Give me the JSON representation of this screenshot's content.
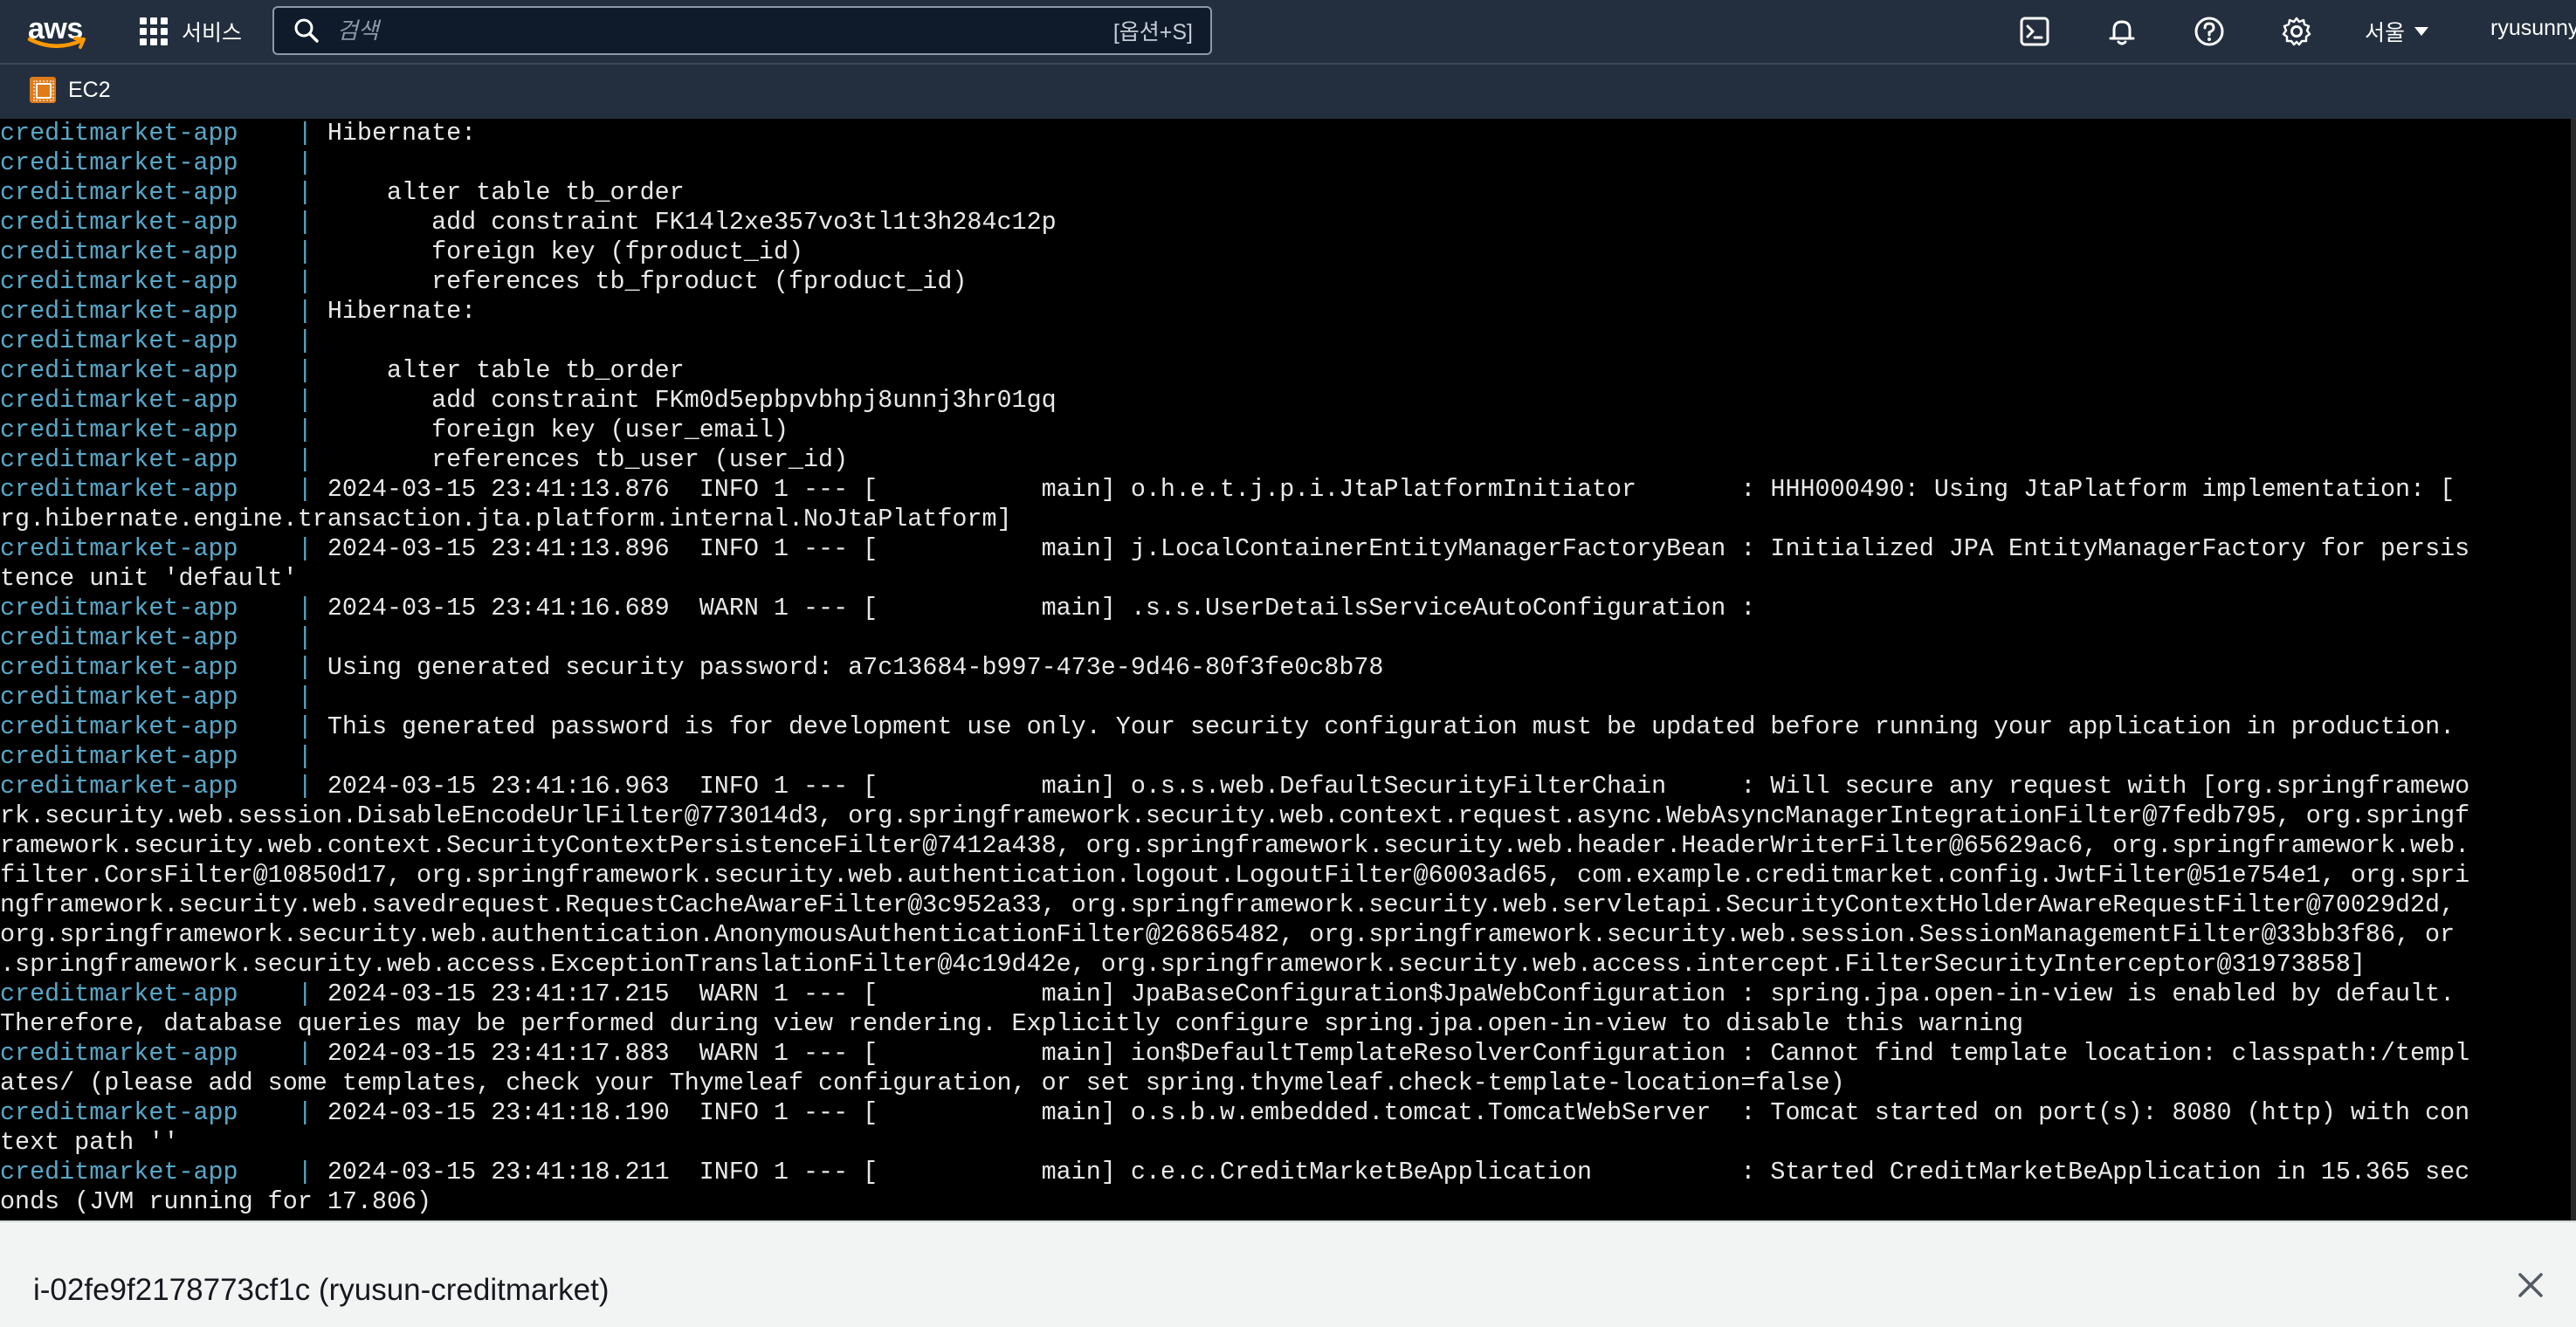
{
  "topnav": {
    "logo_text": "aws",
    "services_label": "서비스",
    "search_placeholder": "검색",
    "search_shortcut": "[옵션+S]",
    "region_label": "서울",
    "user_label": "ryusunny"
  },
  "service_bar": {
    "ec2_label": "EC2"
  },
  "terminal": {
    "prefix": "creditmarket-app    | ",
    "lines": [
      {
        "p": true,
        "t": "Hibernate:"
      },
      {
        "p": true,
        "t": ""
      },
      {
        "p": true,
        "t": "    alter table tb_order"
      },
      {
        "p": true,
        "t": "       add constraint FK14l2xe357vo3tl1t3h284c12p"
      },
      {
        "p": true,
        "t": "       foreign key (fproduct_id)"
      },
      {
        "p": true,
        "t": "       references tb_fproduct (fproduct_id)"
      },
      {
        "p": true,
        "t": "Hibernate:"
      },
      {
        "p": true,
        "t": ""
      },
      {
        "p": true,
        "t": "    alter table tb_order"
      },
      {
        "p": true,
        "t": "       add constraint FKm0d5epbpvbhpj8unnj3hr01gq"
      },
      {
        "p": true,
        "t": "       foreign key (user_email)"
      },
      {
        "p": true,
        "t": "       references tb_user (user_id)"
      },
      {
        "p": true,
        "t": "2024-03-15 23:41:13.876  INFO 1 --- [           main] o.h.e.t.j.p.i.JtaPlatformInitiator       : HHH000490: Using JtaPlatform implementation: ["
      },
      {
        "p": false,
        "t": "rg.hibernate.engine.transaction.jta.platform.internal.NoJtaPlatform]"
      },
      {
        "p": true,
        "t": "2024-03-15 23:41:13.896  INFO 1 --- [           main] j.LocalContainerEntityManagerFactoryBean : Initialized JPA EntityManagerFactory for persis"
      },
      {
        "p": false,
        "t": "tence unit 'default'"
      },
      {
        "p": true,
        "t": "2024-03-15 23:41:16.689  WARN 1 --- [           main] .s.s.UserDetailsServiceAutoConfiguration :"
      },
      {
        "p": true,
        "t": ""
      },
      {
        "p": true,
        "t": "Using generated security password: a7c13684-b997-473e-9d46-80f3fe0c8b78"
      },
      {
        "p": true,
        "t": ""
      },
      {
        "p": true,
        "t": "This generated password is for development use only. Your security configuration must be updated before running your application in production."
      },
      {
        "p": true,
        "t": ""
      },
      {
        "p": true,
        "t": "2024-03-15 23:41:16.963  INFO 1 --- [           main] o.s.s.web.DefaultSecurityFilterChain     : Will secure any request with [org.springframewo"
      },
      {
        "p": false,
        "t": "rk.security.web.session.DisableEncodeUrlFilter@773014d3, org.springframework.security.web.context.request.async.WebAsyncManagerIntegrationFilter@7fedb795, org.springf"
      },
      {
        "p": false,
        "t": "ramework.security.web.context.SecurityContextPersistenceFilter@7412a438, org.springframework.security.web.header.HeaderWriterFilter@65629ac6, org.springframework.web."
      },
      {
        "p": false,
        "t": "filter.CorsFilter@10850d17, org.springframework.security.web.authentication.logout.LogoutFilter@6003ad65, com.example.creditmarket.config.JwtFilter@51e754e1, org.spri"
      },
      {
        "p": false,
        "t": "ngframework.security.web.savedrequest.RequestCacheAwareFilter@3c952a33, org.springframework.security.web.servletapi.SecurityContextHolderAwareRequestFilter@70029d2d,"
      },
      {
        "p": false,
        "t": "org.springframework.security.web.authentication.AnonymousAuthenticationFilter@26865482, org.springframework.security.web.session.SessionManagementFilter@33bb3f86, or"
      },
      {
        "p": false,
        "t": ".springframework.security.web.access.ExceptionTranslationFilter@4c19d42e, org.springframework.security.web.access.intercept.FilterSecurityInterceptor@31973858]"
      },
      {
        "p": true,
        "t": "2024-03-15 23:41:17.215  WARN 1 --- [           main] JpaBaseConfiguration$JpaWebConfiguration : spring.jpa.open-in-view is enabled by default."
      },
      {
        "p": false,
        "t": "Therefore, database queries may be performed during view rendering. Explicitly configure spring.jpa.open-in-view to disable this warning"
      },
      {
        "p": true,
        "t": "2024-03-15 23:41:17.883  WARN 1 --- [           main] ion$DefaultTemplateResolverConfiguration : Cannot find template location: classpath:/templ"
      },
      {
        "p": false,
        "t": "ates/ (please add some templates, check your Thymeleaf configuration, or set spring.thymeleaf.check-template-location=false)"
      },
      {
        "p": true,
        "t": "2024-03-15 23:41:18.190  INFO 1 --- [           main] o.s.b.w.embedded.tomcat.TomcatWebServer  : Tomcat started on port(s): 8080 (http) with con"
      },
      {
        "p": false,
        "t": "text path ''"
      },
      {
        "p": true,
        "t": "2024-03-15 23:41:18.211  INFO 1 --- [           main] c.e.c.CreditMarketBeApplication          : Started CreditMarketBeApplication in 15.365 sec"
      },
      {
        "p": false,
        "t": "onds (JVM running for 17.806)"
      }
    ]
  },
  "session": {
    "title": "i-02fe9f2178773cf1c (ryusun-creditmarket)"
  },
  "colors": {
    "nav_bg": "#232f3e",
    "terminal_bg": "#000000",
    "terminal_text": "#e8e8e8",
    "prefix_text": "#58a8c8",
    "ec2_orange": "#e07b19"
  }
}
